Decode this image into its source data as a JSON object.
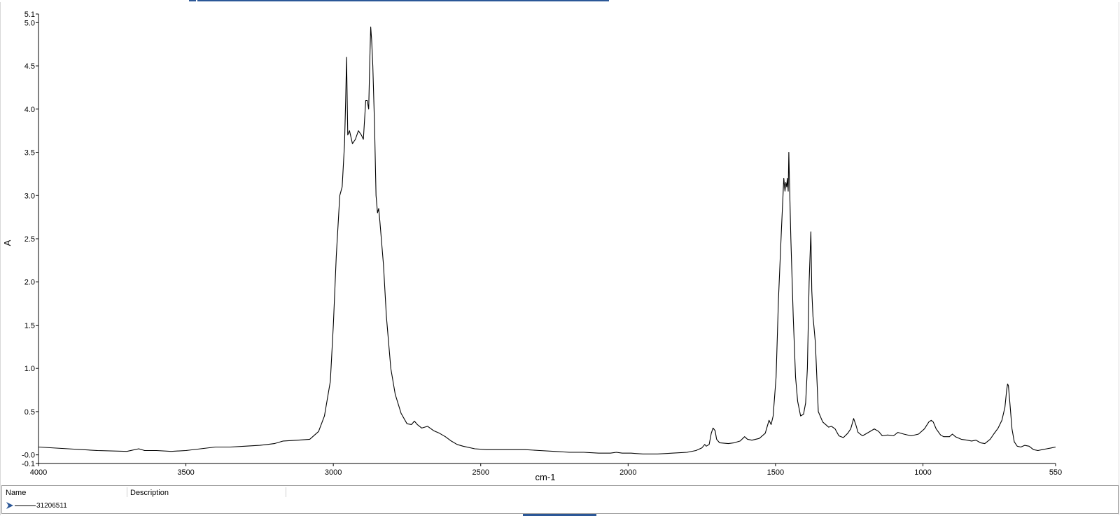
{
  "chart_data": {
    "type": "line",
    "xlabel": "cm-1",
    "ylabel": "A",
    "xlim": [
      4000,
      550
    ],
    "x_reversed": true,
    "ylim": [
      -0.1,
      5.1
    ],
    "x_ticks": [
      4000,
      3500,
      3000,
      2500,
      2000,
      1500,
      1000,
      550
    ],
    "x_tick_labels": [
      "4000",
      "3500",
      "3000",
      "2500",
      "2000",
      "1500",
      "1000",
      "550"
    ],
    "y_ticks": [
      5.1,
      5.0,
      4.5,
      4.0,
      3.5,
      3.0,
      2.5,
      2.0,
      1.5,
      1.0,
      0.5,
      0.0,
      -0.1
    ],
    "y_tick_labels": [
      "5.1",
      "5.0",
      "4.5",
      "4.0",
      "3.5",
      "3.0",
      "2.5",
      "2.0",
      "1.5",
      "1.0",
      "0.5",
      "-0.0",
      "-0.1"
    ],
    "grid": false,
    "series": [
      {
        "name": "31206511",
        "color": "#000000",
        "points": [
          [
            4000,
            0.09
          ],
          [
            3900,
            0.07
          ],
          [
            3800,
            0.05
          ],
          [
            3700,
            0.04
          ],
          [
            3660,
            0.07
          ],
          [
            3640,
            0.05
          ],
          [
            3600,
            0.05
          ],
          [
            3550,
            0.04
          ],
          [
            3500,
            0.05
          ],
          [
            3450,
            0.07
          ],
          [
            3400,
            0.09
          ],
          [
            3350,
            0.09
          ],
          [
            3300,
            0.1
          ],
          [
            3250,
            0.11
          ],
          [
            3200,
            0.13
          ],
          [
            3170,
            0.16
          ],
          [
            3120,
            0.17
          ],
          [
            3080,
            0.18
          ],
          [
            3050,
            0.27
          ],
          [
            3030,
            0.45
          ],
          [
            3010,
            0.85
          ],
          [
            3000,
            1.5
          ],
          [
            2990,
            2.3
          ],
          [
            2978,
            3.0
          ],
          [
            2970,
            3.1
          ],
          [
            2962,
            3.6
          ],
          [
            2958,
            4.1
          ],
          [
            2955,
            4.6
          ],
          [
            2951,
            3.7
          ],
          [
            2945,
            3.75
          ],
          [
            2935,
            3.6
          ],
          [
            2925,
            3.65
          ],
          [
            2915,
            3.75
          ],
          [
            2905,
            3.7
          ],
          [
            2898,
            3.65
          ],
          [
            2890,
            4.1
          ],
          [
            2885,
            4.1
          ],
          [
            2880,
            4.0
          ],
          [
            2876,
            4.6
          ],
          [
            2873,
            4.95
          ],
          [
            2870,
            4.8
          ],
          [
            2866,
            4.5
          ],
          [
            2860,
            3.8
          ],
          [
            2855,
            3.0
          ],
          [
            2850,
            2.8
          ],
          [
            2846,
            2.85
          ],
          [
            2842,
            2.7
          ],
          [
            2830,
            2.2
          ],
          [
            2820,
            1.6
          ],
          [
            2805,
            1.0
          ],
          [
            2790,
            0.7
          ],
          [
            2770,
            0.48
          ],
          [
            2750,
            0.36
          ],
          [
            2735,
            0.35
          ],
          [
            2725,
            0.39
          ],
          [
            2715,
            0.35
          ],
          [
            2700,
            0.31
          ],
          [
            2680,
            0.33
          ],
          [
            2660,
            0.28
          ],
          [
            2640,
            0.25
          ],
          [
            2620,
            0.21
          ],
          [
            2600,
            0.16
          ],
          [
            2580,
            0.12
          ],
          [
            2560,
            0.1
          ],
          [
            2520,
            0.07
          ],
          [
            2480,
            0.06
          ],
          [
            2400,
            0.06
          ],
          [
            2350,
            0.06
          ],
          [
            2300,
            0.05
          ],
          [
            2250,
            0.04
          ],
          [
            2200,
            0.03
          ],
          [
            2150,
            0.03
          ],
          [
            2100,
            0.02
          ],
          [
            2060,
            0.02
          ],
          [
            2040,
            0.03
          ],
          [
            2020,
            0.02
          ],
          [
            1990,
            0.02
          ],
          [
            1950,
            0.01
          ],
          [
            1900,
            0.01
          ],
          [
            1850,
            0.02
          ],
          [
            1800,
            0.03
          ],
          [
            1770,
            0.05
          ],
          [
            1750,
            0.08
          ],
          [
            1740,
            0.12
          ],
          [
            1735,
            0.1
          ],
          [
            1725,
            0.12
          ],
          [
            1718,
            0.25
          ],
          [
            1712,
            0.31
          ],
          [
            1705,
            0.28
          ],
          [
            1700,
            0.18
          ],
          [
            1690,
            0.14
          ],
          [
            1660,
            0.13
          ],
          [
            1640,
            0.14
          ],
          [
            1620,
            0.16
          ],
          [
            1605,
            0.21
          ],
          [
            1595,
            0.18
          ],
          [
            1580,
            0.17
          ],
          [
            1555,
            0.19
          ],
          [
            1535,
            0.25
          ],
          [
            1522,
            0.4
          ],
          [
            1515,
            0.35
          ],
          [
            1508,
            0.45
          ],
          [
            1498,
            0.9
          ],
          [
            1490,
            1.8
          ],
          [
            1480,
            2.6
          ],
          [
            1472,
            3.2
          ],
          [
            1468,
            3.05
          ],
          [
            1465,
            3.15
          ],
          [
            1462,
            3.1
          ],
          [
            1460,
            3.2
          ],
          [
            1457,
            3.05
          ],
          [
            1455,
            3.5
          ],
          [
            1453,
            3.2
          ],
          [
            1448,
            2.5
          ],
          [
            1440,
            1.6
          ],
          [
            1432,
            0.9
          ],
          [
            1425,
            0.62
          ],
          [
            1415,
            0.45
          ],
          [
            1405,
            0.47
          ],
          [
            1398,
            0.6
          ],
          [
            1392,
            1.0
          ],
          [
            1386,
            2.0
          ],
          [
            1380,
            2.58
          ],
          [
            1377,
            1.9
          ],
          [
            1373,
            1.6
          ],
          [
            1370,
            1.5
          ],
          [
            1365,
            1.3
          ],
          [
            1355,
            0.5
          ],
          [
            1340,
            0.38
          ],
          [
            1320,
            0.32
          ],
          [
            1310,
            0.33
          ],
          [
            1298,
            0.3
          ],
          [
            1285,
            0.22
          ],
          [
            1270,
            0.2
          ],
          [
            1255,
            0.25
          ],
          [
            1245,
            0.3
          ],
          [
            1235,
            0.42
          ],
          [
            1228,
            0.35
          ],
          [
            1220,
            0.26
          ],
          [
            1205,
            0.22
          ],
          [
            1185,
            0.26
          ],
          [
            1165,
            0.3
          ],
          [
            1150,
            0.27
          ],
          [
            1138,
            0.22
          ],
          [
            1120,
            0.23
          ],
          [
            1100,
            0.22
          ],
          [
            1085,
            0.26
          ],
          [
            1065,
            0.24
          ],
          [
            1040,
            0.22
          ],
          [
            1015,
            0.24
          ],
          [
            995,
            0.3
          ],
          [
            980,
            0.38
          ],
          [
            972,
            0.4
          ],
          [
            965,
            0.38
          ],
          [
            955,
            0.3
          ],
          [
            940,
            0.23
          ],
          [
            930,
            0.21
          ],
          [
            910,
            0.21
          ],
          [
            900,
            0.24
          ],
          [
            890,
            0.21
          ],
          [
            870,
            0.18
          ],
          [
            850,
            0.17
          ],
          [
            835,
            0.16
          ],
          [
            820,
            0.17
          ],
          [
            805,
            0.14
          ],
          [
            790,
            0.13
          ],
          [
            772,
            0.18
          ],
          [
            760,
            0.24
          ],
          [
            745,
            0.31
          ],
          [
            732,
            0.4
          ],
          [
            722,
            0.55
          ],
          [
            716,
            0.75
          ],
          [
            713,
            0.82
          ],
          [
            710,
            0.8
          ],
          [
            705,
            0.6
          ],
          [
            698,
            0.3
          ],
          [
            690,
            0.15
          ],
          [
            680,
            0.1
          ],
          [
            668,
            0.09
          ],
          [
            655,
            0.11
          ],
          [
            640,
            0.1
          ],
          [
            625,
            0.06
          ],
          [
            610,
            0.05
          ],
          [
            595,
            0.06
          ],
          [
            580,
            0.07
          ],
          [
            565,
            0.08
          ],
          [
            550,
            0.09
          ]
        ]
      }
    ]
  },
  "legend_table": {
    "headers": {
      "name": "Name",
      "description": "Description"
    },
    "rows": [
      {
        "name": "31206511",
        "description": ""
      }
    ]
  },
  "colors": {
    "accent": "#2b5797",
    "curve": "#000000",
    "axis": "#000000",
    "border": "#a0a0a0"
  }
}
